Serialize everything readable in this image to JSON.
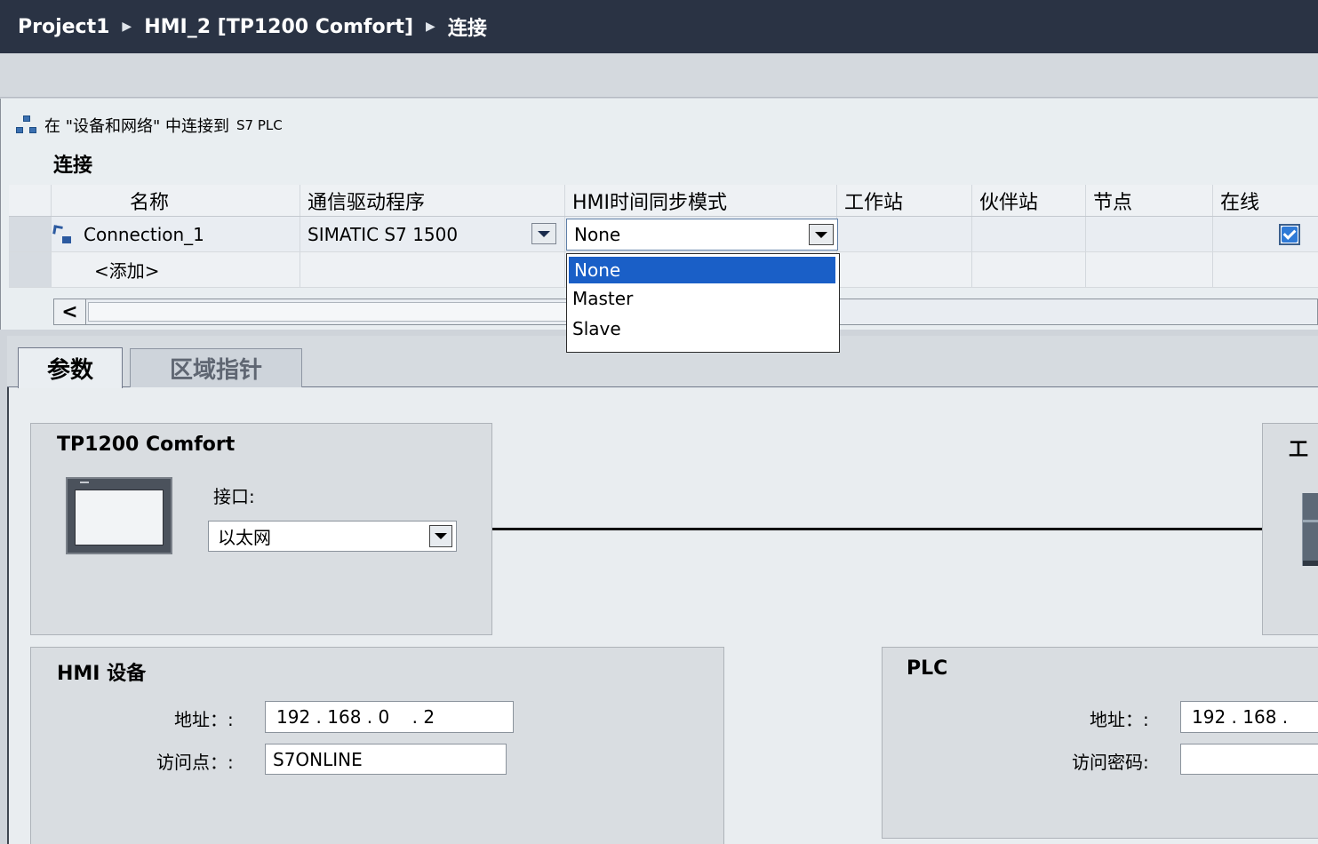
{
  "breadcrumb": {
    "project": "Project1",
    "device": "HMI_2 [TP1200 Comfort]",
    "page": "连接"
  },
  "connect_link": {
    "prefix": "在 \"设备和网络\" 中连接到",
    "suffix": "S7 PLC"
  },
  "section_title": "连接",
  "table": {
    "headers": [
      "名称",
      "通信驱动程序",
      "HMI时间同步模式",
      "工作站",
      "伙伴站",
      "节点",
      "在线"
    ],
    "rows": [
      {
        "name": "Connection_1",
        "driver": "SIMATIC S7 1500",
        "time_sync": "None",
        "station": "",
        "partner": "",
        "node": "",
        "online": true
      }
    ],
    "add_label": "<添加>"
  },
  "dropdown": {
    "options": [
      "None",
      "Master",
      "Slave"
    ],
    "selected": "None"
  },
  "tabs": {
    "params": "参数",
    "area_pointer": "区域指针"
  },
  "device_panel": {
    "title": "TP1200 Comfort",
    "interface_label": "接口:",
    "interface_value": "以太网"
  },
  "right_panel": {
    "title_partial": "工"
  },
  "hmi_panel": {
    "title": "HMI 设备",
    "address_label": "地址：:",
    "address_value": "192 . 168 . 0    . 2",
    "access_point_label": "访问点：:",
    "access_point_value": "S7ONLINE"
  },
  "plc_panel": {
    "title": "PLC",
    "address_label": "地址：:",
    "address_value": "192 . 168 .",
    "password_label": "访问密码:",
    "password_value": ""
  },
  "colors": {
    "title_bar": "#2a3344",
    "selection": "#1a5fc7",
    "panel": "#d9dde1"
  }
}
